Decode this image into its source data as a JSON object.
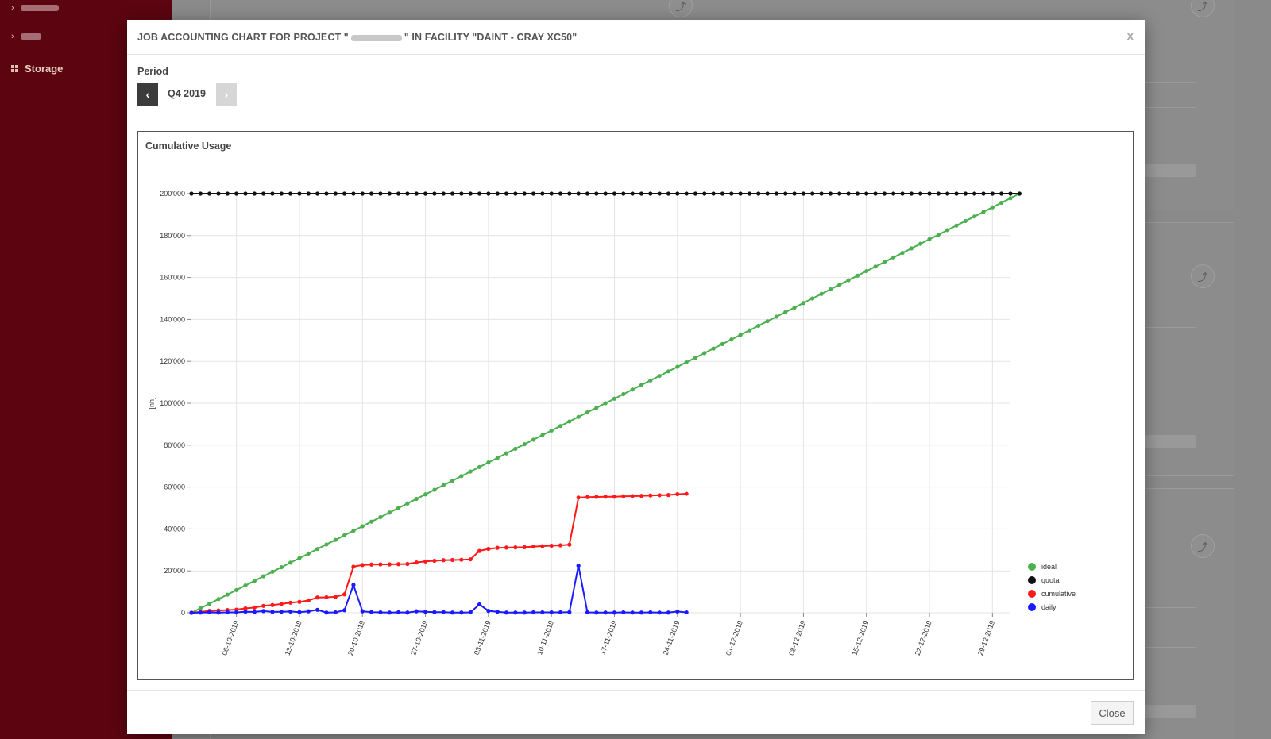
{
  "sidebar": {
    "items": [
      {
        "label": "",
        "icon": "chevron-right-icon"
      },
      {
        "label": "",
        "icon": "chevron-right-icon"
      },
      {
        "label": "Storage",
        "icon": "grid-icon"
      }
    ]
  },
  "modal": {
    "title_prefix": "JOB ACCOUNTING CHART FOR PROJECT \"",
    "title_suffix": "\" IN FACILITY \"DAINT - CRAY XC50\"",
    "close_x": "x",
    "period_label": "Period",
    "period_value": "Q4 2019",
    "prev_icon": "‹",
    "next_icon": "›",
    "panel_title": "Cumulative Usage",
    "close_button": "Close"
  },
  "chart_data": {
    "type": "line",
    "ylabel": "[nh]",
    "xlabel": "",
    "ylim": [
      0,
      200000
    ],
    "y_ticks": [
      "0",
      "20'000",
      "40'000",
      "60'000",
      "80'000",
      "100'000",
      "120'000",
      "140'000",
      "160'000",
      "180'000",
      "200'000"
    ],
    "x_ticks": [
      "06-10-2019",
      "13-10-2019",
      "20-10-2019",
      "27-10-2019",
      "03-11-2019",
      "10-11-2019",
      "17-11-2019",
      "24-11-2019",
      "01-12-2019",
      "08-12-2019",
      "15-12-2019",
      "22-12-2019",
      "29-12-2019"
    ],
    "x_start": "2019-10-01",
    "x_end": "2019-12-31",
    "grid": true,
    "legend_position": "bottom-right",
    "series": [
      {
        "name": "ideal",
        "color": "#4caf50",
        "start": 0,
        "end": 200000,
        "days": 92
      },
      {
        "name": "quota",
        "color": "#111111",
        "constant": 200000,
        "days": 92
      },
      {
        "name": "cumulative",
        "color": "#ff1a1a",
        "values": [
          0,
          400,
          900,
          1100,
          1300,
          1500,
          2100,
          2500,
          3300,
          3700,
          4200,
          4800,
          5200,
          5900,
          7300,
          7400,
          7600,
          8800,
          22000,
          22800,
          23000,
          23100,
          23100,
          23200,
          23300,
          24000,
          24500,
          24800,
          25100,
          25200,
          25300,
          25500,
          29500,
          30500,
          31000,
          31100,
          31200,
          31300,
          31600,
          31800,
          32000,
          32200,
          32500,
          55000,
          55200,
          55300,
          55400,
          55400,
          55600,
          55700,
          55800,
          56000,
          56100,
          56200,
          56600,
          56800
        ]
      },
      {
        "name": "daily",
        "color": "#1a1aff",
        "values": [
          0,
          100,
          200,
          100,
          200,
          200,
          500,
          400,
          800,
          400,
          500,
          600,
          300,
          700,
          1400,
          100,
          200,
          1200,
          13300,
          700,
          300,
          200,
          100,
          200,
          100,
          700,
          500,
          300,
          300,
          100,
          100,
          200,
          4000,
          900,
          500,
          100,
          100,
          100,
          200,
          200,
          200,
          200,
          300,
          22500,
          200,
          100,
          100,
          100,
          200,
          100,
          100,
          200,
          100,
          100,
          600,
          200
        ]
      }
    ]
  }
}
